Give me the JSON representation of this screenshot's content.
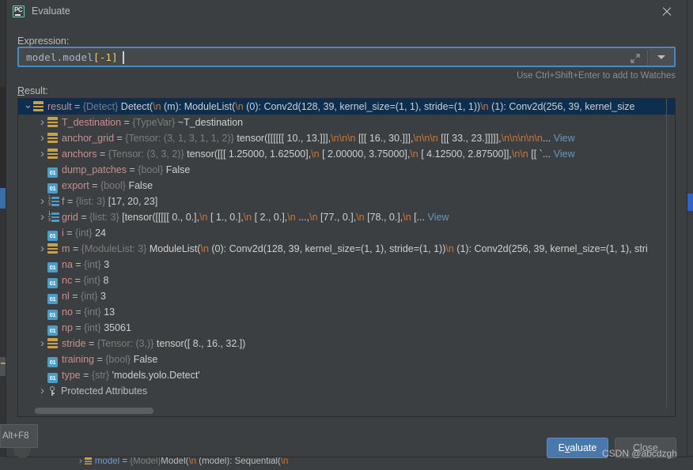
{
  "window": {
    "title": "Evaluate",
    "app_icon": "pycharm-icon",
    "close_icon": "close-icon"
  },
  "expression": {
    "label": "Expression:",
    "value_prefix": "model.model",
    "value_bracket": "[-1]",
    "full_value": "model.model[-1]",
    "expand_icon": "expand-icon",
    "dropdown_icon": "chevron-down-icon",
    "hint": "Use Ctrl+Shift+Enter to add to Watches"
  },
  "result": {
    "label_mnemonic": "R",
    "label_rest": "esult:",
    "rows": [
      {
        "indent": 0,
        "twisty": "open",
        "icon": "obj",
        "selected": true,
        "name": "result",
        "type": "{Detect}",
        "value": "Detect(\\n  (m): ModuleList(\\n     (0): Conv2d(128, 39, kernel_size=(1, 1), stride=(1, 1))\\n    (1): Conv2d(256, 39, kernel_size",
        "view": ""
      },
      {
        "indent": 1,
        "twisty": "closed",
        "icon": "obj",
        "selected": false,
        "name": "T_destination",
        "type": "{TypeVar}",
        "value": "~T_destination",
        "view": ""
      },
      {
        "indent": 1,
        "twisty": "closed",
        "icon": "obj",
        "selected": false,
        "name": "anchor_grid",
        "type": "{Tensor: (3, 1, 3, 1, 1, 2)}",
        "value": "tensor([[[[[[ 10.,  13.]]],\\n\\n\\n          [[[ 16.,  30.]]],\\n\\n\\n          [[[ 33.,  23.]]]]],\\n\\n\\n\\n\\n...",
        "view": "View"
      },
      {
        "indent": 1,
        "twisty": "closed",
        "icon": "obj",
        "selected": false,
        "name": "anchors",
        "type": "{Tensor: (3, 3, 2)}",
        "value": "tensor([[[ 1.25000,  1.62500],\\n         [ 2.00000,  3.75000],\\n         [ 4.12500,  2.87500]],\\n\\n        [[ `...",
        "view": "View"
      },
      {
        "indent": 1,
        "twisty": "none",
        "icon": "prim",
        "selected": false,
        "name": "dump_patches",
        "type": "{bool}",
        "value": "False",
        "view": ""
      },
      {
        "indent": 1,
        "twisty": "none",
        "icon": "prim",
        "selected": false,
        "name": "export",
        "type": "{bool}",
        "value": "False",
        "view": ""
      },
      {
        "indent": 1,
        "twisty": "closed",
        "icon": "list",
        "selected": false,
        "name": "f",
        "type": "{list: 3}",
        "value": "[17, 20, 23]",
        "view": ""
      },
      {
        "indent": 1,
        "twisty": "closed",
        "icon": "list",
        "selected": false,
        "name": "grid",
        "type": "{list: 3}",
        "value": "[tensor([[[[[ 0.,   0.],\\n           [ 1.,   0.],\\n           [ 2.,   0.],\\n           ...,\\n           [77.,   0.],\\n           [78.,   0.],\\n    [...",
        "view": "View"
      },
      {
        "indent": 1,
        "twisty": "none",
        "icon": "prim",
        "selected": false,
        "name": "i",
        "type": "{int}",
        "value": "24",
        "view": ""
      },
      {
        "indent": 1,
        "twisty": "closed",
        "icon": "obj",
        "selected": false,
        "name": "m",
        "type": "{ModuleList: 3}",
        "value": "ModuleList(\\n  (0): Conv2d(128, 39, kernel_size=(1, 1), stride=(1, 1))\\n  (1): Conv2d(256, 39, kernel_size=(1, 1), stri",
        "view": ""
      },
      {
        "indent": 1,
        "twisty": "none",
        "icon": "prim",
        "selected": false,
        "name": "na",
        "type": "{int}",
        "value": "3",
        "view": ""
      },
      {
        "indent": 1,
        "twisty": "none",
        "icon": "prim",
        "selected": false,
        "name": "nc",
        "type": "{int}",
        "value": "8",
        "view": ""
      },
      {
        "indent": 1,
        "twisty": "none",
        "icon": "prim",
        "selected": false,
        "name": "nl",
        "type": "{int}",
        "value": "3",
        "view": ""
      },
      {
        "indent": 1,
        "twisty": "none",
        "icon": "prim",
        "selected": false,
        "name": "no",
        "type": "{int}",
        "value": "13",
        "view": ""
      },
      {
        "indent": 1,
        "twisty": "none",
        "icon": "prim",
        "selected": false,
        "name": "np",
        "type": "{int}",
        "value": "35061",
        "view": ""
      },
      {
        "indent": 1,
        "twisty": "closed",
        "icon": "obj",
        "selected": false,
        "name": "stride",
        "type": "{Tensor: (3,)}",
        "value": "tensor([ 8., 16., 32.])",
        "view": ""
      },
      {
        "indent": 1,
        "twisty": "none",
        "icon": "prim",
        "selected": false,
        "name": "training",
        "type": "{bool}",
        "value": "False",
        "view": ""
      },
      {
        "indent": 1,
        "twisty": "none",
        "icon": "prim",
        "selected": false,
        "name": "type",
        "type": "{str}",
        "value": "'models.yolo.Detect'",
        "view": ""
      },
      {
        "indent": 1,
        "twisty": "closed",
        "icon": "key",
        "selected": false,
        "name": "",
        "type": "",
        "value": "",
        "view": "",
        "plain": "Protected Attributes"
      }
    ]
  },
  "buttons": {
    "evaluate_mnemonic": "E",
    "evaluate_prefix": "",
    "evaluate_underlined": "v",
    "evaluate_rest": "aluate",
    "evaluate_label": "Evaluate",
    "close_label": "Close"
  },
  "tooltip": {
    "text": "Alt+F8"
  },
  "watermark": {
    "text": "CSDN @abcdzgh"
  },
  "background": {
    "bottom_row": {
      "name": "model",
      "type": "{Model}",
      "value_a": "Model(",
      "esc_a": "\\n",
      "value_b": "  (model): Sequential(",
      "esc_b": "\\n"
    }
  },
  "colors": {
    "accent_blue": "#4a88c7",
    "selection": "#0d2e4e",
    "var_name": "#c98f8f",
    "var_type": "#7d7d7d",
    "escape": "#cc7832",
    "link": "#6897bb",
    "panel_bg": "#3c3f41",
    "icon_orange": "#c9a14a",
    "icon_teal": "#4b9dc9",
    "app_green": "#5fd6a6"
  }
}
